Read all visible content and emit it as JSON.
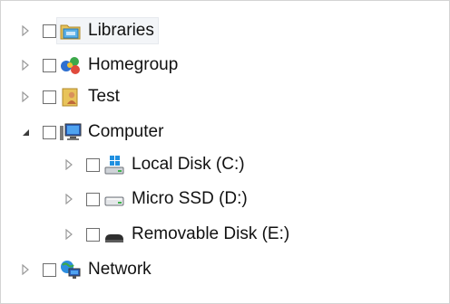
{
  "tree": {
    "items": [
      {
        "label": "Libraries",
        "icon": "libraries-icon",
        "expanded": false,
        "selected": true
      },
      {
        "label": "Homegroup",
        "icon": "homegroup-icon",
        "expanded": false,
        "selected": false
      },
      {
        "label": "Test",
        "icon": "user-folder-icon",
        "expanded": false,
        "selected": false
      },
      {
        "label": "Computer",
        "icon": "computer-icon",
        "expanded": true,
        "selected": false,
        "children": [
          {
            "label": "Local Disk (C:)",
            "icon": "local-disk-icon",
            "expanded": false
          },
          {
            "label": "Micro SSD (D:)",
            "icon": "drive-icon",
            "expanded": false
          },
          {
            "label": "Removable Disk (E:)",
            "icon": "removable-disk-icon",
            "expanded": false
          }
        ]
      },
      {
        "label": "Network",
        "icon": "network-icon",
        "expanded": false,
        "selected": false
      }
    ]
  },
  "colors": {
    "arrow": "#9a9a9a",
    "arrow_expanded": "#3c3c3c",
    "checkbox_border": "#6e6e6e",
    "selection_bg": "#f3f5f8"
  }
}
